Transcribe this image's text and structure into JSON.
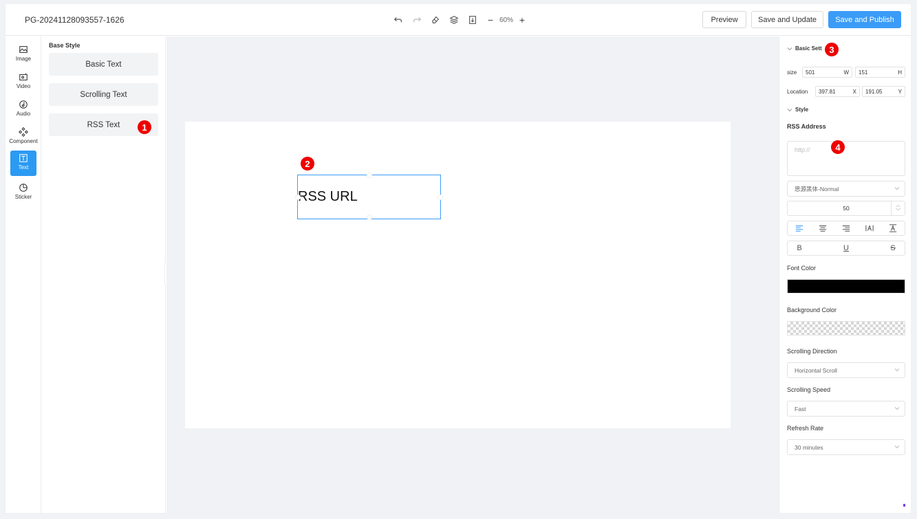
{
  "header": {
    "doc_title": "PG-20241128093557-1626",
    "toolbar_icons": [
      "undo-icon",
      "redo-icon",
      "eraser-icon",
      "layers-icon",
      "align-icon"
    ],
    "zoom_minus": "−",
    "zoom_value": "60%",
    "zoom_plus": "+",
    "preview_label": "Preview",
    "save_update_label": "Save and Update",
    "save_publish_label": "Save and Publish",
    "accent_color": "#3b9cf7"
  },
  "sidebar": {
    "items": [
      {
        "label": "Image",
        "icon": "image-icon"
      },
      {
        "label": "Video",
        "icon": "video-icon"
      },
      {
        "label": "Audio",
        "icon": "audio-icon"
      },
      {
        "label": "Component",
        "icon": "component-icon"
      },
      {
        "label": "Text",
        "icon": "text-icon",
        "active": true
      },
      {
        "label": "Sticker",
        "icon": "sticker-icon"
      }
    ]
  },
  "component_panel": {
    "title": "Base Style",
    "buttons": [
      "Basic Text",
      "Scrolling Text",
      "RSS Text"
    ]
  },
  "canvas": {
    "element_text": "RSS URL"
  },
  "properties": {
    "basic_settings": "Basic Sett",
    "size_label": "size",
    "width_value": "501",
    "width_suffix": "W",
    "height_value": "151",
    "height_suffix": "H",
    "location_label": "Location",
    "x_value": "397.81",
    "x_suffix": "X",
    "y_value": "191.05",
    "y_suffix": "Y",
    "style_section": "Style",
    "rss_address_label": "RSS Address",
    "rss_placeholder": "http://",
    "font_family": "思源黑体-Normal",
    "font_size": "50",
    "font_color_label": "Font Color",
    "font_color": "#000000",
    "background_color_label": "Background Color",
    "scroll_direction_label": "Scrolling Direction",
    "scroll_direction_value": "Horizontal Scroll",
    "scroll_speed_label": "Scrolling Speed",
    "scroll_speed_value": "Fast",
    "refresh_rate_label": "Refresh Rate",
    "refresh_rate_value": "30 minutes"
  },
  "badges": [
    "1",
    "2",
    "3",
    "4"
  ]
}
